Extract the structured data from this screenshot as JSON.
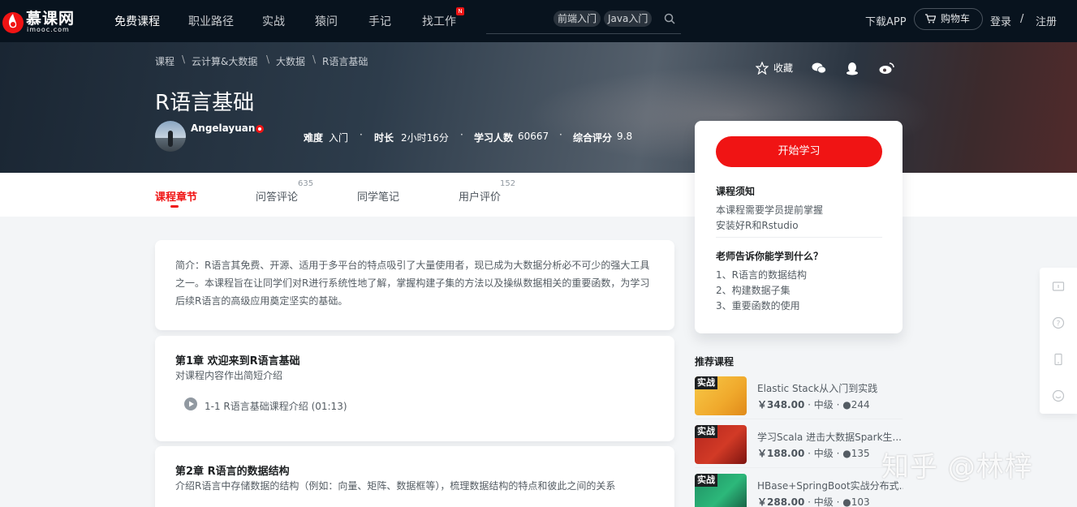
{
  "nav": {
    "logo_text": "慕课网",
    "logo_sub": "imooc.com",
    "items": [
      "免费课程",
      "职业路径",
      "实战",
      "猿问",
      "手记",
      "找工作"
    ],
    "new_badge": "N",
    "search_tags": [
      "前端入门",
      "Java入门"
    ],
    "download_app": "下载APP",
    "cart": "购物车",
    "login": "登录",
    "slash": "/",
    "register": "注册"
  },
  "breadcrumb": [
    "课程",
    "云计算&大数据",
    "大数据",
    "R语言基础"
  ],
  "course": {
    "title": "R语言基础",
    "teacher": "Angelayuan",
    "difficulty_label": "难度",
    "difficulty": "入门",
    "duration_label": "时长",
    "duration": "2小时16分",
    "students_label": "学习人数",
    "students": "60667",
    "rating_label": "综合评分",
    "rating": "9.8",
    "favorite": "收藏"
  },
  "tabs": [
    {
      "label": "课程章节",
      "count": ""
    },
    {
      "label": "问答评论",
      "count": "635"
    },
    {
      "label": "同学笔记",
      "count": ""
    },
    {
      "label": "用户评价",
      "count": "152"
    }
  ],
  "intro": "简介：R语言其免费、开源、适用于多平台的特点吸引了大量使用者，现已成为大数据分析必不可少的强大工具之一。本课程旨在让同学们对R进行系统性地了解，掌握构建子集的方法以及操纵数据相关的重要函数，为学习后续R语言的高级应用奠定坚实的基础。",
  "chapters": [
    {
      "title": "第1章 欢迎来到R语言基础",
      "desc": "对课程内容作出简短介绍",
      "lesson": "1-1 R语言基础课程介绍 (01:13)"
    },
    {
      "title": "第2章 R语言的数据结构",
      "desc": "介绍R语言中存储数据的结构（例如：向量、矩阵、数据框等），梳理数据结构的特点和彼此之间的关系"
    }
  ],
  "side": {
    "start": "开始学习",
    "notice_title": "课程须知",
    "notice_lines": [
      "本课程需要学员提前掌握",
      "安装好R和Rstudio"
    ],
    "learn_title": "老师告诉你能学到什么？",
    "learn_lines": [
      "1、R语言的数据结构",
      "2、构建数据子集",
      "3、重要函数的使用"
    ]
  },
  "recommend": {
    "title": "推荐课程",
    "items": [
      {
        "tag": "实战",
        "name": "Elastic Stack从入门到实践",
        "price": "￥348.00",
        "level": "中级",
        "students": "244"
      },
      {
        "tag": "实战",
        "name": "学习Scala 进击大数据Spark生...",
        "price": "￥188.00",
        "level": "中级",
        "students": "135"
      },
      {
        "tag": "实战",
        "name": "HBase+SpringBoot实战分布式...",
        "price": "￥288.00",
        "level": "中级",
        "students": "103"
      }
    ]
  },
  "watermark": "知乎 @林梓",
  "colors": {
    "accent": "#f01414",
    "nav_bg": "#08131e",
    "page_bg": "#f3f5f7"
  }
}
